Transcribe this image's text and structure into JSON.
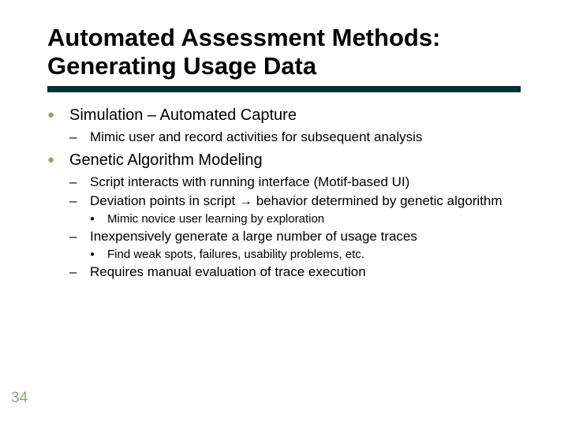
{
  "slide": {
    "page_number": "34",
    "title_line1": "Automated Assessment Methods:",
    "title_line2": "Generating Usage Data",
    "bullets": [
      {
        "text": "Simulation – Automated Capture",
        "children": [
          {
            "text": "Mimic user and record activities for subsequent analysis"
          }
        ]
      },
      {
        "text": "Genetic Algorithm Modeling",
        "children": [
          {
            "text": "Script interacts with running interface (Motif-based UI)"
          },
          {
            "text_prefix": "Deviation points in script ",
            "text_suffix": " behavior determined by genetic algorithm",
            "children": [
              {
                "text": "Mimic novice user learning by exploration"
              }
            ]
          },
          {
            "text": "Inexpensively generate a large number of usage traces",
            "children": [
              {
                "text": "Find weak spots, failures, usability problems, etc."
              }
            ]
          },
          {
            "text": "Requires manual evaluation of trace execution"
          }
        ]
      }
    ]
  }
}
